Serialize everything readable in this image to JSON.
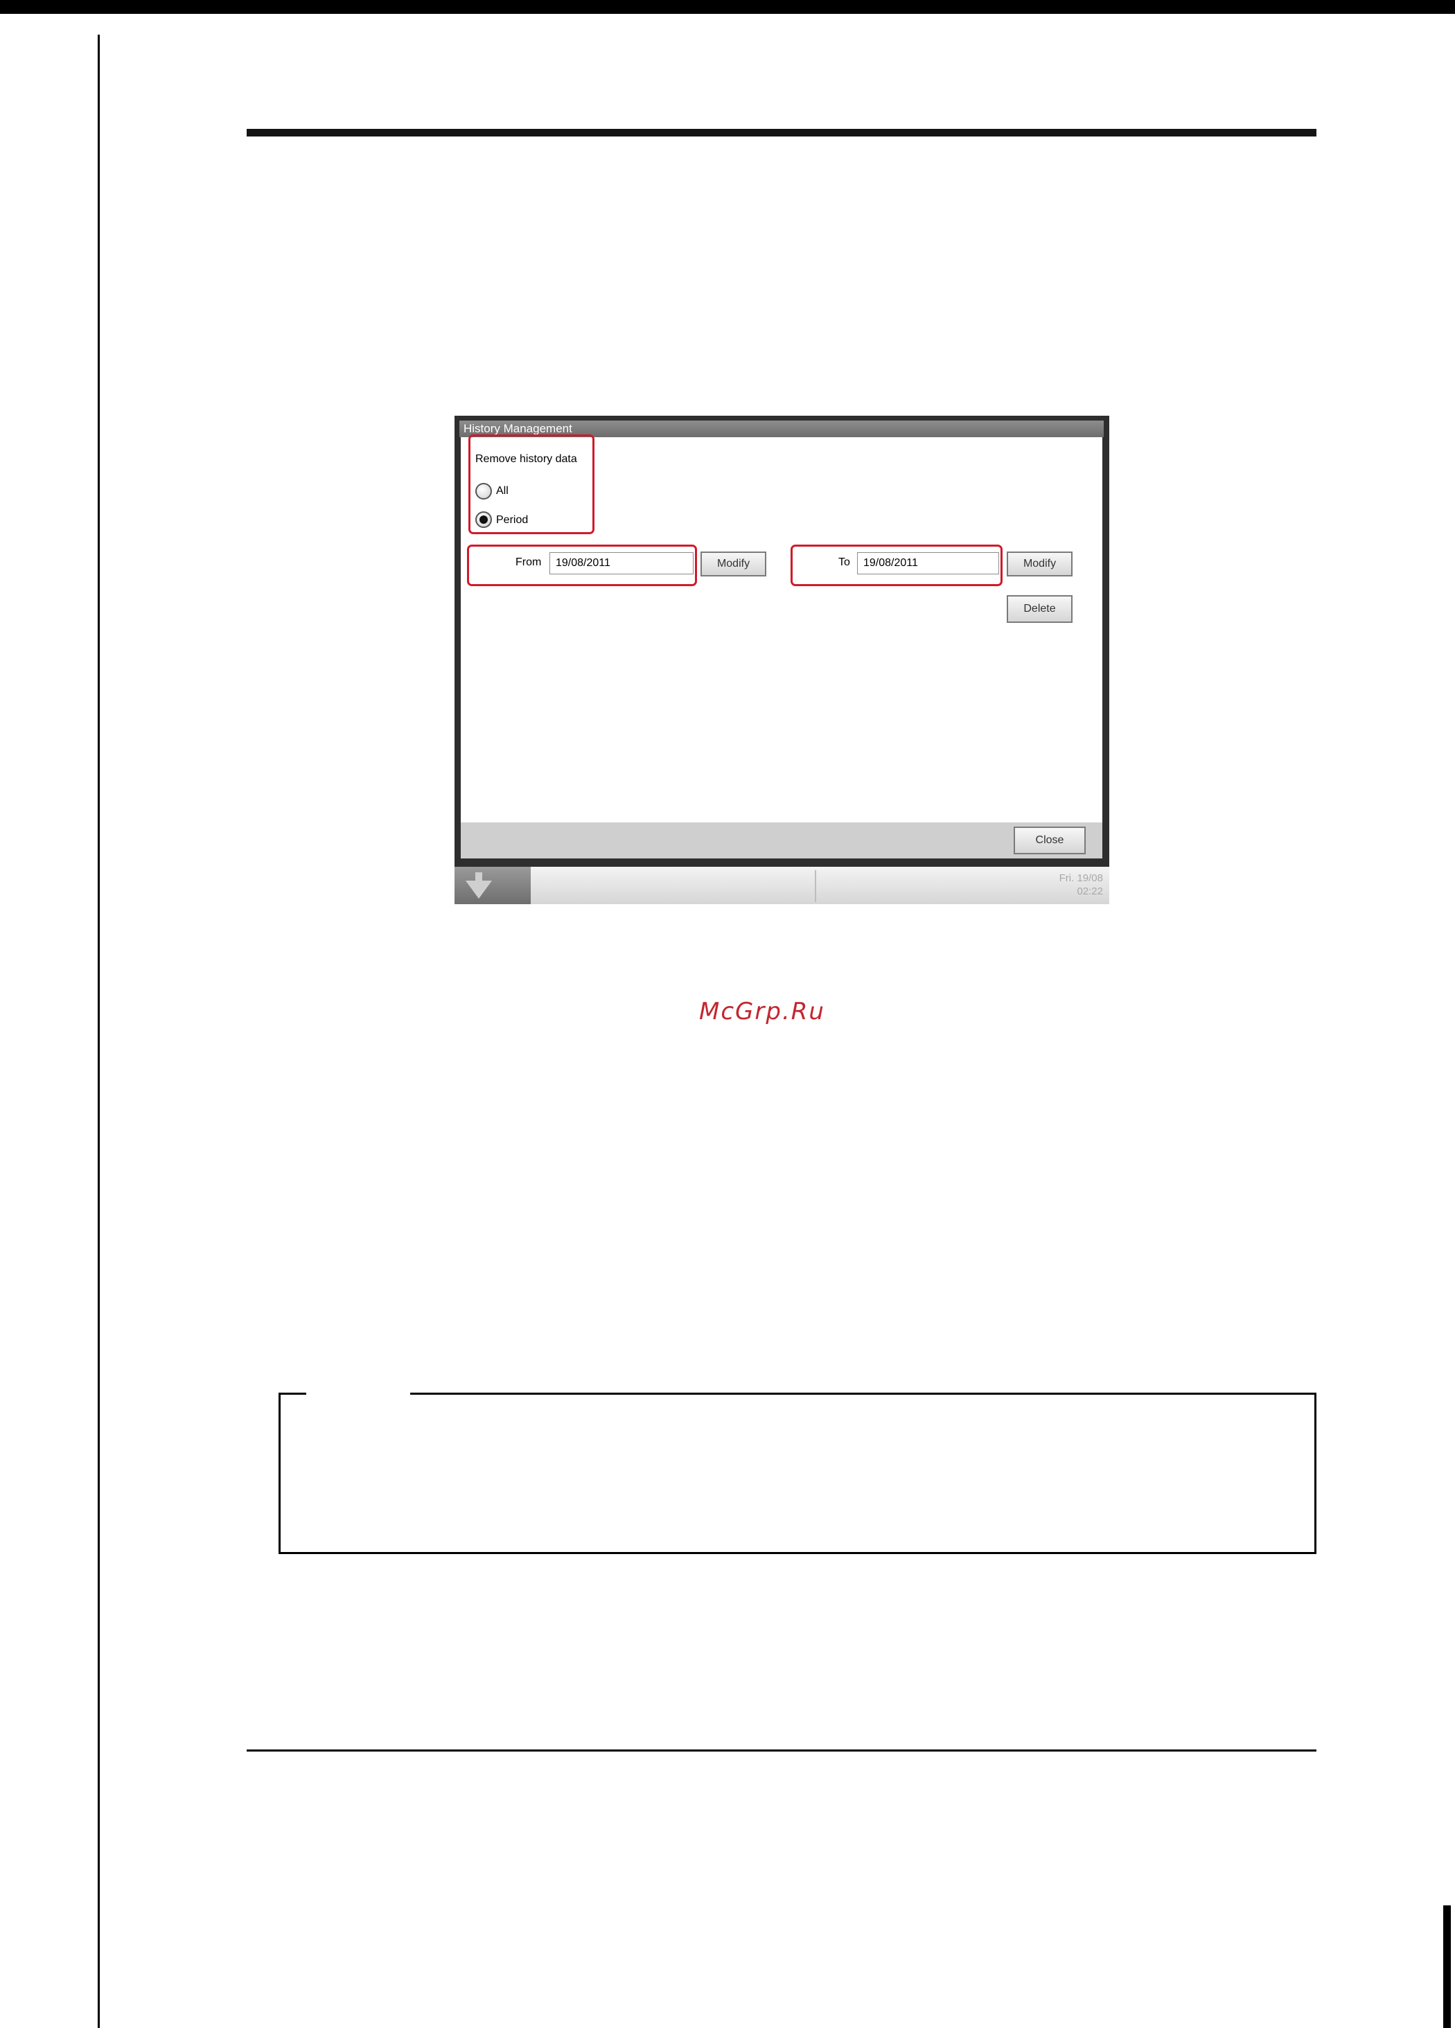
{
  "watermark": "McGrp.Ru",
  "screenshot": {
    "window_title": "History Management",
    "group_label": "Remove history data",
    "radio_all_label": "All",
    "radio_period_label": "Period",
    "selected_option": "Period",
    "from_label": "From",
    "from_value": "19/08/2011",
    "to_label": "To",
    "to_value": "19/08/2011",
    "modify_label": "Modify",
    "delete_label": "Delete",
    "close_label": "Close",
    "clock_day": "Fri. 19/08",
    "clock_time": "02:22"
  }
}
